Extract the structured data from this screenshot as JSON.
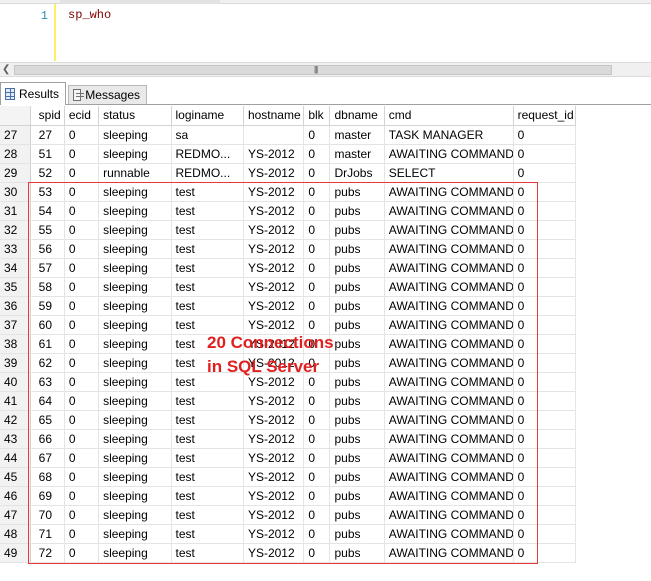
{
  "editor": {
    "line_number": "1",
    "code": "sp_who"
  },
  "tabs": {
    "results_label": "Results",
    "messages_label": "Messages"
  },
  "grid": {
    "columns": [
      "spid",
      "ecid",
      "status",
      "loginame",
      "hostname",
      "blk",
      "dbname",
      "cmd",
      "request_id"
    ],
    "rows": [
      {
        "n": "27",
        "cells": [
          "27",
          "0",
          "sleeping",
          "sa",
          "",
          "0",
          "master",
          "TASK MANAGER",
          "0"
        ]
      },
      {
        "n": "28",
        "cells": [
          "51",
          "0",
          "sleeping",
          "REDMO...",
          "YS-2012",
          "0",
          "master",
          "AWAITING COMMAND",
          "0"
        ]
      },
      {
        "n": "29",
        "cells": [
          "52",
          "0",
          "runnable",
          "REDMO...",
          "YS-2012",
          "0",
          "DrJobs",
          "SELECT",
          "0"
        ]
      },
      {
        "n": "30",
        "cells": [
          "53",
          "0",
          "sleeping",
          "test",
          "YS-2012",
          "0",
          "pubs",
          "AWAITING COMMAND",
          "0"
        ]
      },
      {
        "n": "31",
        "cells": [
          "54",
          "0",
          "sleeping",
          "test",
          "YS-2012",
          "0",
          "pubs",
          "AWAITING COMMAND",
          "0"
        ]
      },
      {
        "n": "32",
        "cells": [
          "55",
          "0",
          "sleeping",
          "test",
          "YS-2012",
          "0",
          "pubs",
          "AWAITING COMMAND",
          "0"
        ]
      },
      {
        "n": "33",
        "cells": [
          "56",
          "0",
          "sleeping",
          "test",
          "YS-2012",
          "0",
          "pubs",
          "AWAITING COMMAND",
          "0"
        ]
      },
      {
        "n": "34",
        "cells": [
          "57",
          "0",
          "sleeping",
          "test",
          "YS-2012",
          "0",
          "pubs",
          "AWAITING COMMAND",
          "0"
        ]
      },
      {
        "n": "35",
        "cells": [
          "58",
          "0",
          "sleeping",
          "test",
          "YS-2012",
          "0",
          "pubs",
          "AWAITING COMMAND",
          "0"
        ]
      },
      {
        "n": "36",
        "cells": [
          "59",
          "0",
          "sleeping",
          "test",
          "YS-2012",
          "0",
          "pubs",
          "AWAITING COMMAND",
          "0"
        ]
      },
      {
        "n": "37",
        "cells": [
          "60",
          "0",
          "sleeping",
          "test",
          "YS-2012",
          "0",
          "pubs",
          "AWAITING COMMAND",
          "0"
        ]
      },
      {
        "n": "38",
        "cells": [
          "61",
          "0",
          "sleeping",
          "test",
          "YS-2012",
          "0",
          "pubs",
          "AWAITING COMMAND",
          "0"
        ]
      },
      {
        "n": "39",
        "cells": [
          "62",
          "0",
          "sleeping",
          "test",
          "YS-2012",
          "0",
          "pubs",
          "AWAITING COMMAND",
          "0"
        ]
      },
      {
        "n": "40",
        "cells": [
          "63",
          "0",
          "sleeping",
          "test",
          "YS-2012",
          "0",
          "pubs",
          "AWAITING COMMAND",
          "0"
        ]
      },
      {
        "n": "41",
        "cells": [
          "64",
          "0",
          "sleeping",
          "test",
          "YS-2012",
          "0",
          "pubs",
          "AWAITING COMMAND",
          "0"
        ]
      },
      {
        "n": "42",
        "cells": [
          "65",
          "0",
          "sleeping",
          "test",
          "YS-2012",
          "0",
          "pubs",
          "AWAITING COMMAND",
          "0"
        ]
      },
      {
        "n": "43",
        "cells": [
          "66",
          "0",
          "sleeping",
          "test",
          "YS-2012",
          "0",
          "pubs",
          "AWAITING COMMAND",
          "0"
        ]
      },
      {
        "n": "44",
        "cells": [
          "67",
          "0",
          "sleeping",
          "test",
          "YS-2012",
          "0",
          "pubs",
          "AWAITING COMMAND",
          "0"
        ]
      },
      {
        "n": "45",
        "cells": [
          "68",
          "0",
          "sleeping",
          "test",
          "YS-2012",
          "0",
          "pubs",
          "AWAITING COMMAND",
          "0"
        ]
      },
      {
        "n": "46",
        "cells": [
          "69",
          "0",
          "sleeping",
          "test",
          "YS-2012",
          "0",
          "pubs",
          "AWAITING COMMAND",
          "0"
        ]
      },
      {
        "n": "47",
        "cells": [
          "70",
          "0",
          "sleeping",
          "test",
          "YS-2012",
          "0",
          "pubs",
          "AWAITING COMMAND",
          "0"
        ]
      },
      {
        "n": "48",
        "cells": [
          "71",
          "0",
          "sleeping",
          "test",
          "YS-2012",
          "0",
          "pubs",
          "AWAITING COMMAND",
          "0"
        ]
      },
      {
        "n": "49",
        "cells": [
          "72",
          "0",
          "sleeping",
          "test",
          "YS-2012",
          "0",
          "pubs",
          "AWAITING COMMAND",
          "0"
        ]
      }
    ]
  },
  "annotation": {
    "line1": "20 Connections",
    "line2": "in SQL Server",
    "color": "#e02020"
  },
  "icons": {
    "results_tab": "results-grid-icon",
    "messages_tab": "messages-icon",
    "scroll_left": "chevron-left-icon",
    "scroll_grip": "scroll-grip-icon"
  }
}
